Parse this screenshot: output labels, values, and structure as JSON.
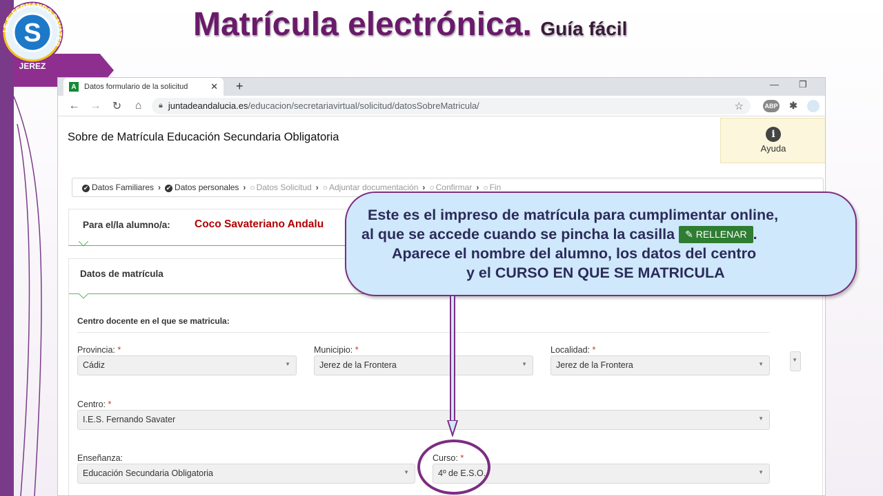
{
  "slide": {
    "title": "Matrícula electrónica.",
    "subtitle": "Guía fácil",
    "logo_top_text": "I.E.S. FERNANDO SAVATER",
    "logo_bottom_text": "JEREZ"
  },
  "browser": {
    "tab_title": "Datos formulario de la solicitud",
    "favicon_text": "A",
    "url_host": "juntadeandalucia.es",
    "url_path": "/educacion/secretariavirtual/solicitud/datosSobreMatricula/",
    "ext_abp": "ABP"
  },
  "page": {
    "title": "Sobre de Matrícula Educación Secundaria Obligatoria",
    "help_label": "Ayuda",
    "steps": [
      "Datos Familiares",
      "Datos personales",
      "Datos Solicitud",
      "Adjuntar documentación",
      "Confirmar",
      "Fin"
    ],
    "student_label": "Para el/la alumno/a:",
    "student_name": "Coco Savateriano Andalu",
    "matricula_title": "Datos de matrícula",
    "centro_section": "Centro docente en el que se matricula:",
    "fields": {
      "provincia": {
        "label": "Provincia:",
        "value": "Cádiz"
      },
      "municipio": {
        "label": "Municipio:",
        "value": "Jerez de la Frontera"
      },
      "localidad": {
        "label": "Localidad:",
        "value": "Jerez de la Frontera"
      },
      "centro": {
        "label": "Centro:",
        "value": "I.E.S. Fernando Savater"
      },
      "ensenanza": {
        "label": "Enseñanza:",
        "value": "Educación Secundaria Obligatoria"
      },
      "curso": {
        "label": "Curso:",
        "value": "4º de E.S.O."
      }
    },
    "required_mark": "*"
  },
  "callout": {
    "line1": "Este es el impreso de matrícula para cumplimentar online,",
    "line2": "al que se accede cuando se pincha la casilla",
    "button": "RELLENAR",
    "line2_end": ".",
    "line3": "Aparece el nombre del alumno, los datos del centro",
    "line4": "y el CURSO EN QUE SE MATRICULA"
  },
  "colors": {
    "title": "#6a1a6a",
    "accent_purple": "#7b2d82",
    "callout_bg": "#cfe8fb",
    "student_name": "#b00000",
    "rellenar_button": "#2e7d32",
    "success_line": "#5cb85c"
  }
}
